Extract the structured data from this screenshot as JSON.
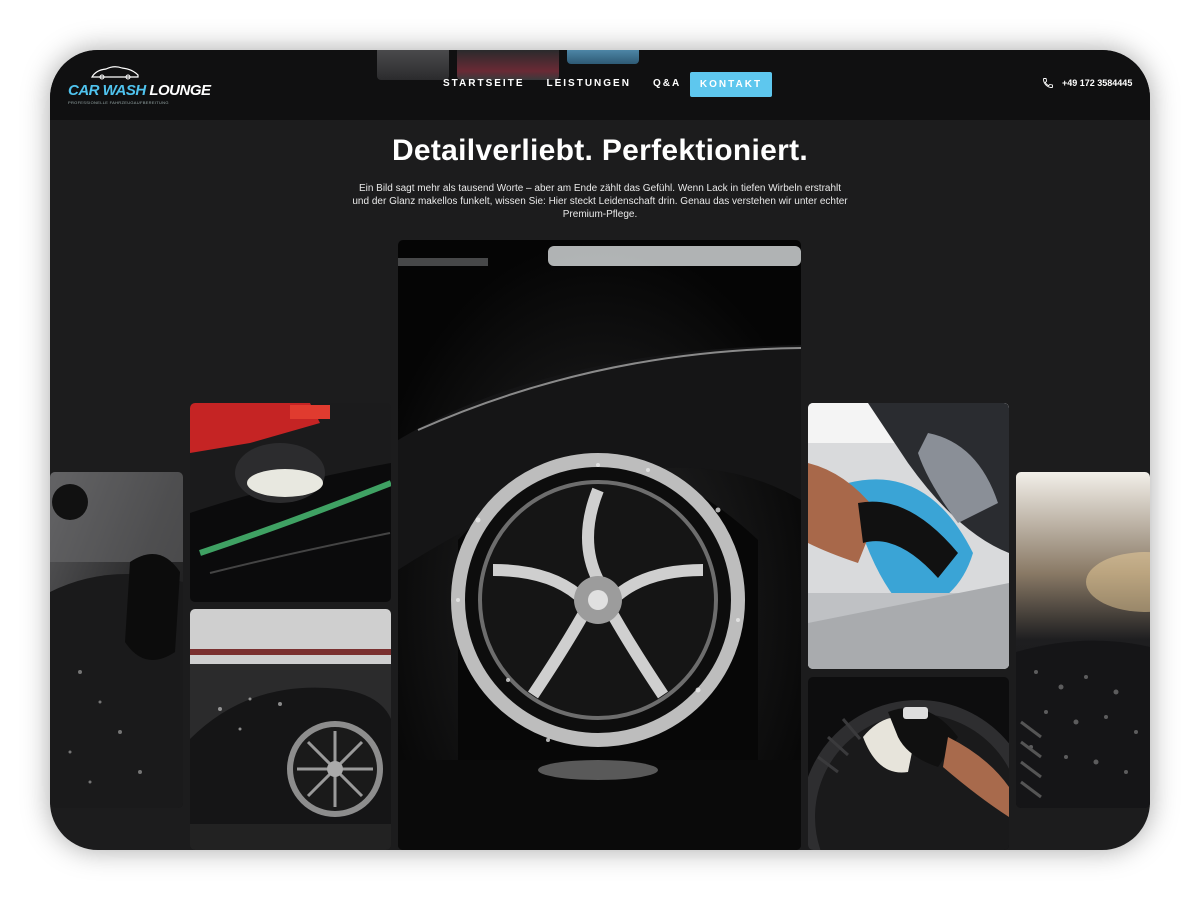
{
  "header": {
    "logo": {
      "name_part1": "CAR WASH ",
      "name_part2": "LOUNGE",
      "tagline": "PROFESSIONELLE FAHRZEUGAUFBEREITUNG"
    },
    "nav": [
      {
        "label": "STARTSEITE"
      },
      {
        "label": "LEISTUNGEN"
      },
      {
        "label": "Q&A"
      }
    ],
    "cta_label": "KONTAKT",
    "phone": "+49 172 3584445",
    "phone_icon": "phone-icon"
  },
  "hero": {
    "title": "Detailverliebt. Perfektioniert.",
    "text": "Ein Bild sagt mehr als tausend Worte – aber am Ende zählt das Gefühl. Wenn Lack in tiefen Wirbeln erstrahlt und der Glanz makellos funkelt, wissen Sie: Hier steckt Leidenschaft drin. Genau das verstehen wir unter echter Premium-Pflege."
  },
  "gallery": [
    {
      "subject": "hand-washing-car-photo"
    },
    {
      "subject": "polishing-machine-photo"
    },
    {
      "subject": "foamed-porsche-photo"
    },
    {
      "subject": "foamed-wheel-photo"
    },
    {
      "subject": "microfiber-headlight-photo"
    },
    {
      "subject": "tire-brushing-photo"
    },
    {
      "subject": "water-beading-photo"
    }
  ],
  "colors": {
    "accent": "#5ec7ee",
    "background": "#1c1c1d",
    "topbar": "#101011"
  }
}
